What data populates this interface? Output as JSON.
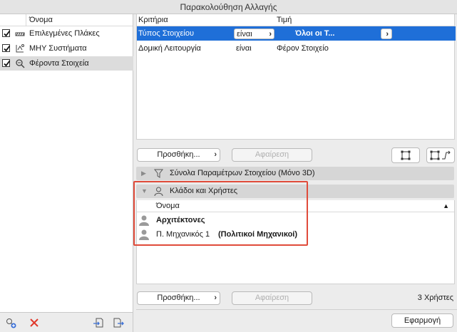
{
  "window": {
    "title": "Παρακολούθηση Αλλαγής"
  },
  "left_panel": {
    "column_header": "Όνομα",
    "items": [
      {
        "label": "Επιλεγμένες Πλάκες",
        "checked": true,
        "icon": "slab-icon"
      },
      {
        "label": "ΜΗΥ Συστήματα",
        "checked": true,
        "icon": "mep-icon"
      },
      {
        "label": "Φέροντα Στοιχεία",
        "checked": true,
        "icon": "structural-icon",
        "selected": true
      }
    ]
  },
  "criteria": {
    "headers": {
      "criteria": "Κριτήρια",
      "value": "Τιμή"
    },
    "rows": [
      {
        "criterion": "Τύπος Στοιχείου",
        "operator": "είναι",
        "value": "Όλοι οι Τ...",
        "selected": true
      },
      {
        "criterion": "Δομική Λειτουργία",
        "operator": "είναι",
        "value": "Φέρον Στοιχείο",
        "selected": false
      }
    ],
    "add_label": "Προσθήκη...",
    "remove_label": "Αφαίρεση"
  },
  "sections": {
    "param_sets": "Σύνολα Παραμέτρων Στοιχείου (Μόνο 3D)",
    "branches_users": "Κλάδοι και Χρήστες"
  },
  "users": {
    "column_header": "Όνομα",
    "rows": [
      {
        "name": "Αρχιτέκτονες",
        "role": "",
        "bold": true
      },
      {
        "name": "Π. Μηχανικός 1",
        "role": "(Πολιτικοί Μηχανικοί)",
        "bold": false
      }
    ],
    "add_label": "Προσθήκη...",
    "remove_label": "Αφαίρεση",
    "count_label": "3 Χρήστες"
  },
  "footer": {
    "apply_label": "Εφαρμογή"
  },
  "colors": {
    "selection": "#1f6fd8",
    "highlight": "#e04b3a",
    "delete": "#e0382b"
  }
}
